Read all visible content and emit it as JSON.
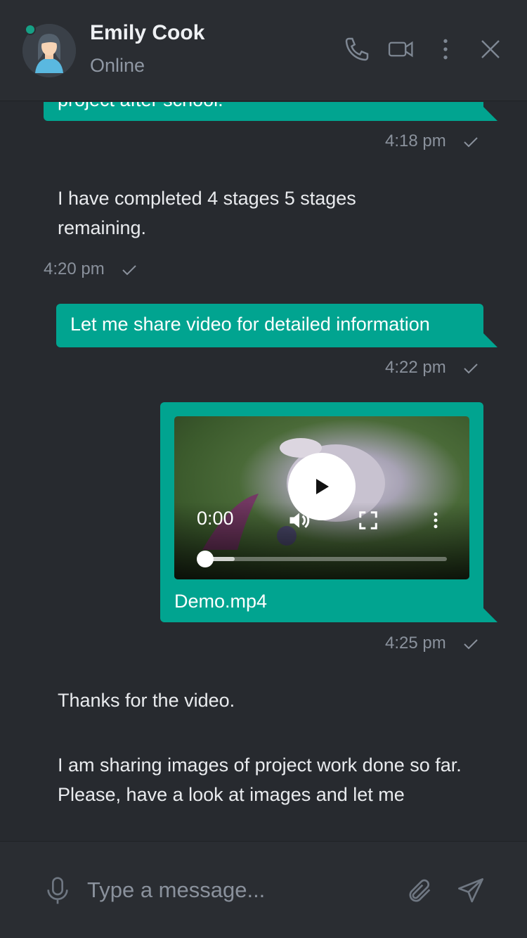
{
  "contact": {
    "name": "Emily Cook",
    "status": "Online"
  },
  "header_icons": [
    "phone-icon",
    "video-camera-icon",
    "more-vertical-icon",
    "close-icon"
  ],
  "messages": [
    {
      "type": "outgoing",
      "text": "project after school.",
      "time": "4:18 pm"
    },
    {
      "type": "incoming",
      "text": "I have completed 4 stages 5 stages remaining.",
      "time": "4:20 pm"
    },
    {
      "type": "outgoing",
      "text": "Let me share video for detailed information",
      "time": "4:22 pm"
    },
    {
      "type": "outgoing-video",
      "filename": "Demo.mp4",
      "current_time": "0:00",
      "time": "4:25 pm"
    },
    {
      "type": "incoming",
      "lines": [
        "Thanks for the video.",
        "I am sharing images of project work done so far.",
        "Please, have a look at images and let me"
      ]
    }
  ],
  "composer": {
    "placeholder": "Type a message..."
  },
  "colors": {
    "accent": "#01a490",
    "background": "#272a2f",
    "online": "#16a085"
  }
}
